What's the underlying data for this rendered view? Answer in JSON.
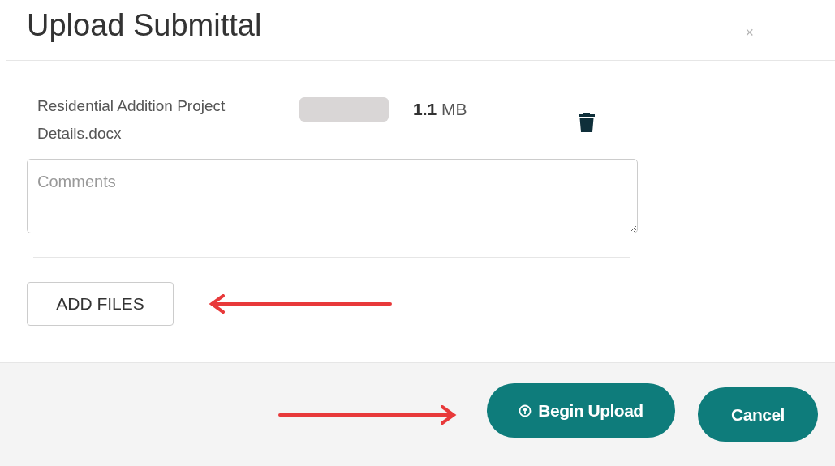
{
  "dialog": {
    "title": "Upload Submittal",
    "close": "×"
  },
  "file": {
    "name": "Residential Addition Project Details.docx",
    "level": 0,
    "size": "**1.1** MB"
  },
  "comments": {
    "placeholder": "Comments"
  },
  "add_files": "ADD FILES",
  "footer": {
    "buttons": [
      {
        "label": "Begin Upload",
        "kind": "upload"
      },
      {
        "label": "Cancel",
        "kind": "plain"
      }
    ]
  }
}
